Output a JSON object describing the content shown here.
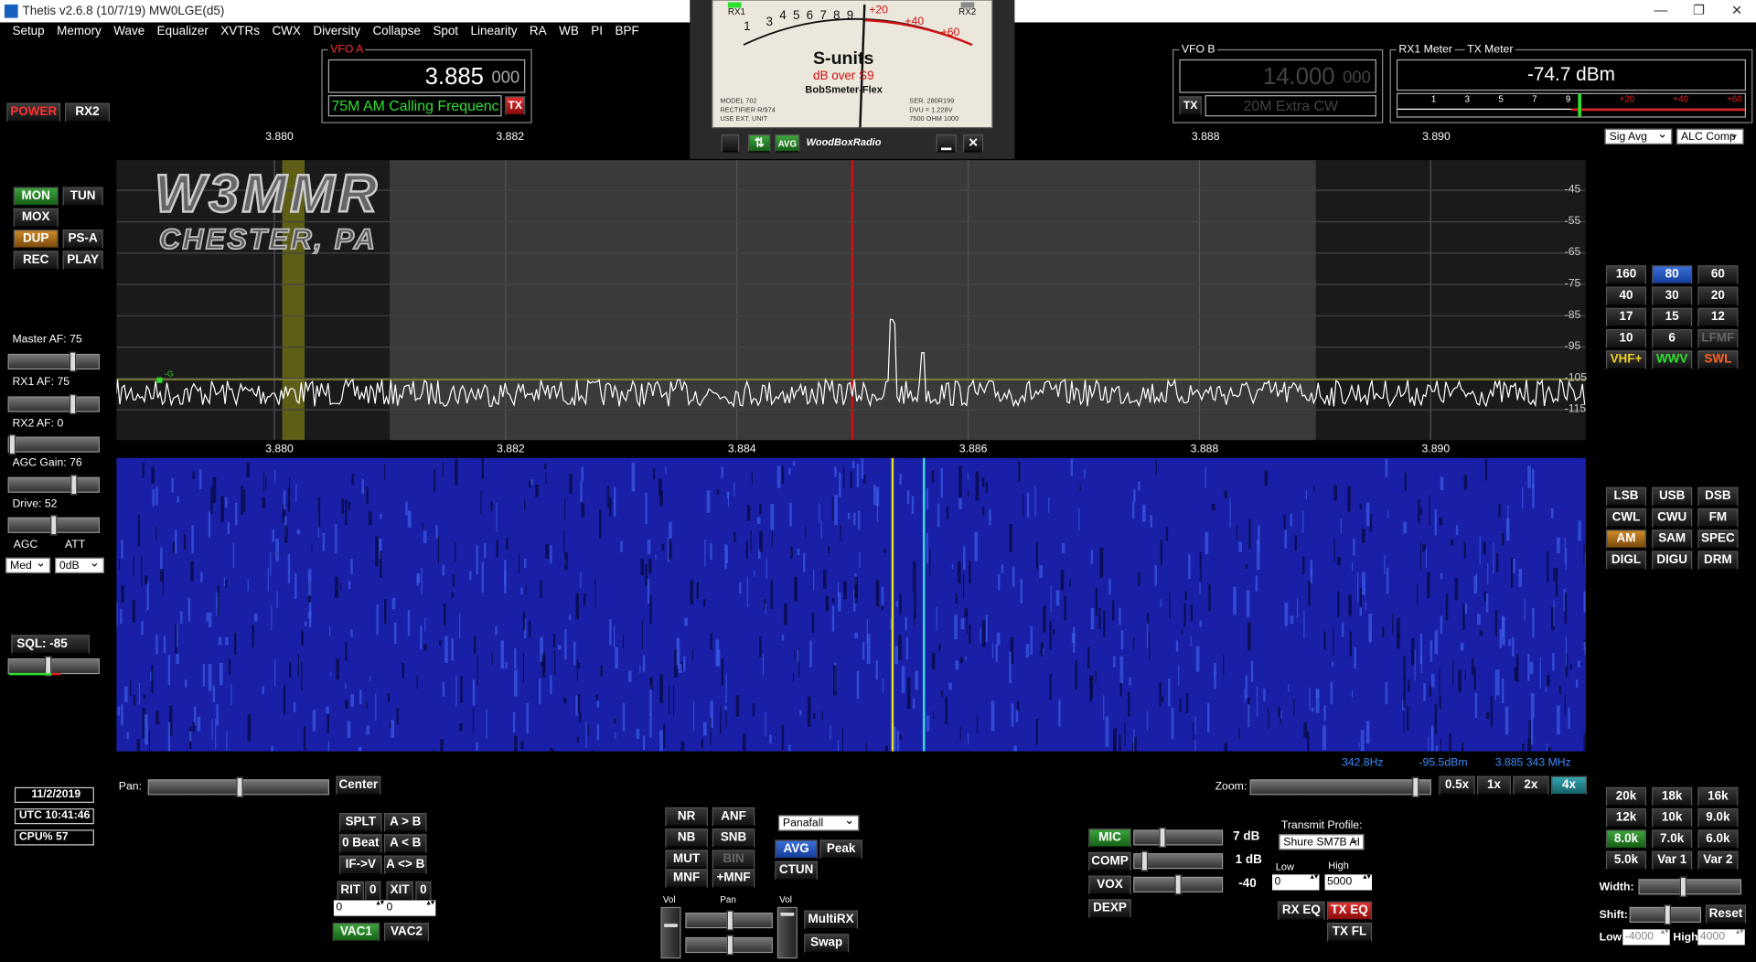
{
  "window": {
    "title": "Thetis v2.6.8 (10/7/19) MW0LGE(d5)",
    "min": "—",
    "restore": "❐",
    "close": "✕"
  },
  "menu": [
    "Setup",
    "Memory",
    "Wave",
    "Equalizer",
    "XVTRs",
    "CWX",
    "Diversity",
    "Collapse",
    "Spot",
    "Linearity",
    "RA",
    "WB",
    "PI",
    "BPF"
  ],
  "power": {
    "power_label": "POWER",
    "rx2_label": "RX2"
  },
  "vfo_a": {
    "label": "VFO A",
    "freq_main": "3.885",
    "freq_sub": "000",
    "memo": "75M AM Calling Frequenc",
    "tx": "TX"
  },
  "vfo_b": {
    "label": "VFO B",
    "freq_main": "14.000",
    "freq_sub": "000",
    "memo": "20M Extra CW",
    "tx": "TX"
  },
  "meter": {
    "rx1_label": "RX1",
    "rx2_label": "RX2",
    "scale_black": [
      "1",
      "3",
      "4",
      "5",
      "6",
      "7",
      "8",
      "9"
    ],
    "scale_red": [
      "+20",
      "+40",
      "+60"
    ],
    "title": "S-units",
    "subtitle": "dB over S9",
    "brand": "BobSmeter-Flex",
    "avg": "AVG",
    "woodbox": "WoodBoxRadio",
    "model": "MODEL  702",
    "rectifier": "RECTIFIER  R/974",
    "ext": "USE EXT. UNIT",
    "ser": "SER.  280R199",
    "dvu": "DVU = 1.228V",
    "imp": "7500 OHM 1000"
  },
  "rx1meter": {
    "label": "RX1 Meter",
    "tx_label": "TX Meter",
    "value": "-74.7 dBm",
    "scale": [
      "1",
      "3",
      "5",
      "7",
      "9",
      "+20",
      "+40",
      "+60"
    ],
    "level": 0.52,
    "sel1": "Sig Avg",
    "sel2": "ALC Comp"
  },
  "top_freqs": [
    {
      "f": "3.880"
    },
    {
      "f": "3.882"
    },
    {
      "f": "3.888"
    },
    {
      "f": "3.890"
    }
  ],
  "pan_freqs": [
    "3.880",
    "3.882",
    "3.884",
    "3.886",
    "3.888",
    "3.890"
  ],
  "db_labels": [
    "-45",
    "-55",
    "-65",
    "-75",
    "-85",
    "-95",
    "-105",
    "-115"
  ],
  "callsign": {
    "line1": "W3MMR",
    "line2": "CHESTER, PA"
  },
  "left_buttons": {
    "mon": "MON",
    "tun": "TUN",
    "mox": "MOX",
    "dup": "DUP",
    "psa": "PS-A",
    "rec": "REC",
    "play": "PLAY"
  },
  "sliders": {
    "master_af": "Master AF:  75",
    "rx1_af": "RX1 AF:  75",
    "rx2_af": "RX2 AF:  0",
    "agc_gain": "AGC Gain:  76",
    "drive": "Drive:  52",
    "master_af_v": 0.75,
    "rx1_af_v": 0.75,
    "rx2_af_v": 0.0,
    "agc_gain_v": 0.76,
    "drive_v": 0.52
  },
  "agc": {
    "agc_label": "AGC",
    "att_label": "ATT",
    "agc_val": "Med",
    "att_val": "0dB"
  },
  "sql": {
    "label": "SQL:  -85",
    "v": 0.45
  },
  "status": {
    "date": "11/2/2019",
    "utc": "UTC 10:41:46",
    "cpu": "CPU%  57"
  },
  "bands": [
    "160",
    "80",
    "60",
    "40",
    "30",
    "20",
    "17",
    "15",
    "12",
    "10",
    "6",
    "LFMF",
    "VHF+",
    "WWV",
    "SWL"
  ],
  "modes": [
    "LSB",
    "USB",
    "DSB",
    "CWL",
    "CWU",
    "FM",
    "AM",
    "SAM",
    "SPEC",
    "DIGL",
    "DIGU",
    "DRM"
  ],
  "filters": [
    "20k",
    "18k",
    "16k",
    "12k",
    "10k",
    "9.0k",
    "8.0k",
    "7.0k",
    "6.0k",
    "5.0k",
    "Var 1",
    "Var 2"
  ],
  "cursor": {
    "hz": "342.8Hz",
    "dbm": "-95.5dBm",
    "freq": "3.885 343 MHz"
  },
  "pan": {
    "label": "Pan:",
    "center": "Center",
    "zoom": "Zoom:",
    "z05": "0.5x",
    "z1": "1x",
    "z2": "2x",
    "z4": "4x"
  },
  "vfo_ops": {
    "splt": "SPLT",
    "ab": "A > B",
    "beat": "0 Beat",
    "ba": "A < B",
    "ifv": "IF->V",
    "swap": "A <> B",
    "rit": "RIT",
    "rit_v": "0",
    "xit": "XIT",
    "xit_v": "0",
    "rit_spin": "0",
    "xit_spin": "0",
    "vac1": "VAC1",
    "vac2": "VAC2"
  },
  "dsp": {
    "nr": "NR",
    "anf": "ANF",
    "nb": "NB",
    "snb": "SNB",
    "mut": "MUT",
    "bin": "BIN",
    "mnf": "MNF",
    "pmnf": "+MNF"
  },
  "display": {
    "mode": "Panafall",
    "avg": "AVG",
    "peak": "Peak",
    "ctun": "CTUN"
  },
  "rx2ctl": {
    "vol": "Vol",
    "pan": "Pan",
    "vol2": "Vol",
    "multirx": "MultiRX",
    "swap": "Swap"
  },
  "tx": {
    "mic": "MIC",
    "mic_db": "7 dB",
    "comp": "COMP",
    "comp_db": "1 dB",
    "vox": "VOX",
    "vox_v": "-40",
    "dexp": "DEXP",
    "profile_label": "Transmit Profile:",
    "profile": "Shure SM7B AI",
    "low_label": "Low",
    "high_label": "High",
    "low": "0",
    "high": "5000",
    "rxeq": "RX EQ",
    "txeq": "TX EQ",
    "txfl": "TX FL"
  },
  "filter_ctl": {
    "width": "Width:",
    "shift": "Shift:",
    "reset": "Reset",
    "low": "Low",
    "low_v": "-4000",
    "high": "High",
    "high_v": "4000"
  }
}
